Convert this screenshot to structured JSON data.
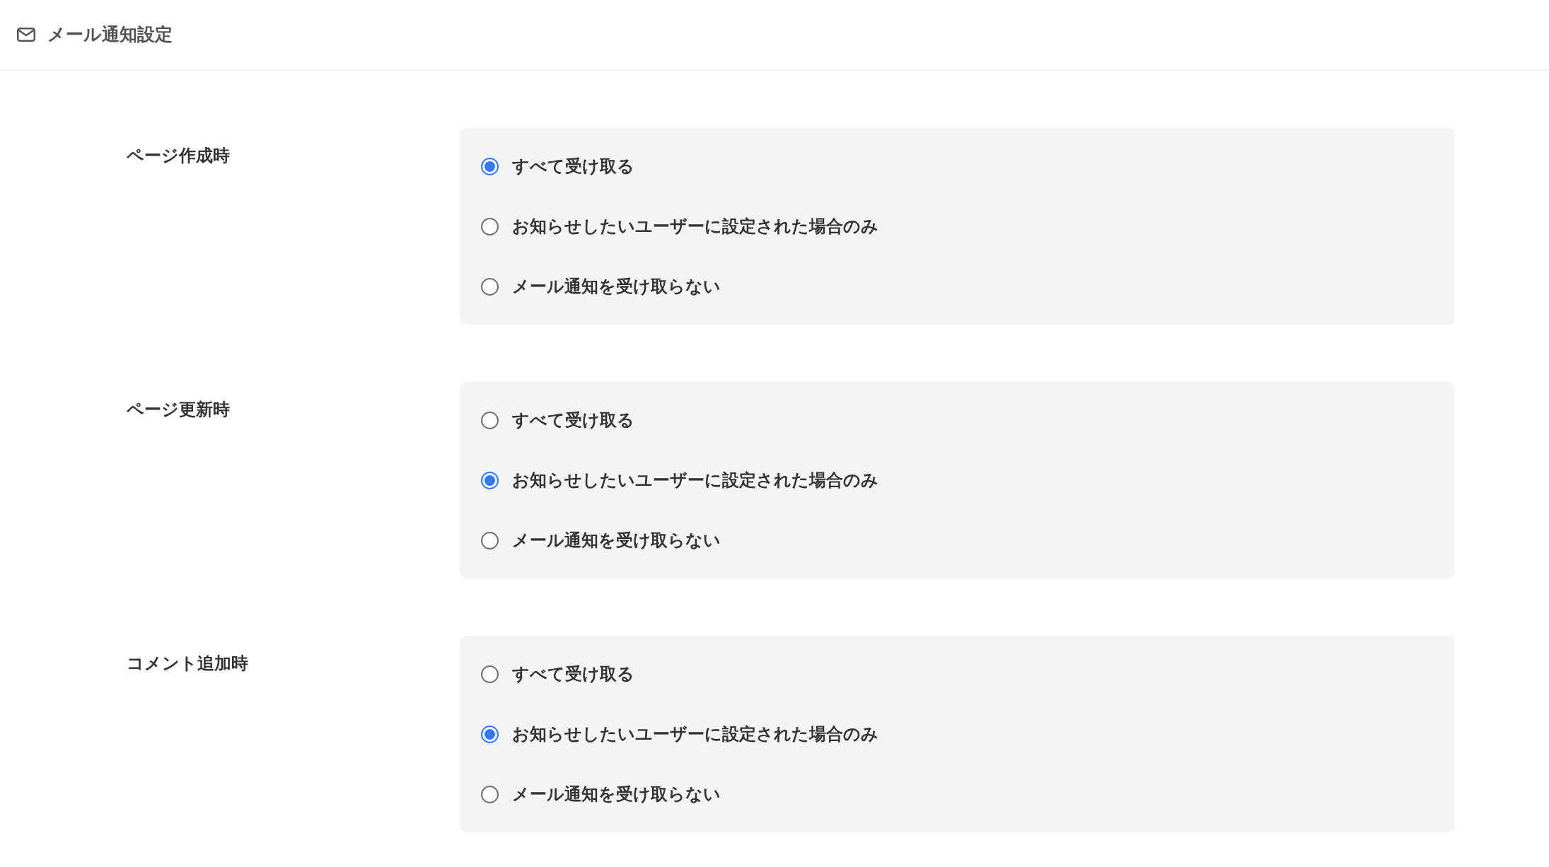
{
  "header": {
    "title": "メール通知設定"
  },
  "sections": [
    {
      "label": "ページ作成時",
      "options": [
        {
          "label": "すべて受け取る",
          "selected": true
        },
        {
          "label": "お知らせしたいユーザーに設定された場合のみ",
          "selected": false
        },
        {
          "label": "メール通知を受け取らない",
          "selected": false
        }
      ]
    },
    {
      "label": "ページ更新時",
      "options": [
        {
          "label": "すべて受け取る",
          "selected": false
        },
        {
          "label": "お知らせしたいユーザーに設定された場合のみ",
          "selected": true
        },
        {
          "label": "メール通知を受け取らない",
          "selected": false
        }
      ]
    },
    {
      "label": "コメント追加時",
      "options": [
        {
          "label": "すべて受け取る",
          "selected": false
        },
        {
          "label": "お知らせしたいユーザーに設定された場合のみ",
          "selected": true
        },
        {
          "label": "メール通知を受け取らない",
          "selected": false
        }
      ]
    }
  ]
}
